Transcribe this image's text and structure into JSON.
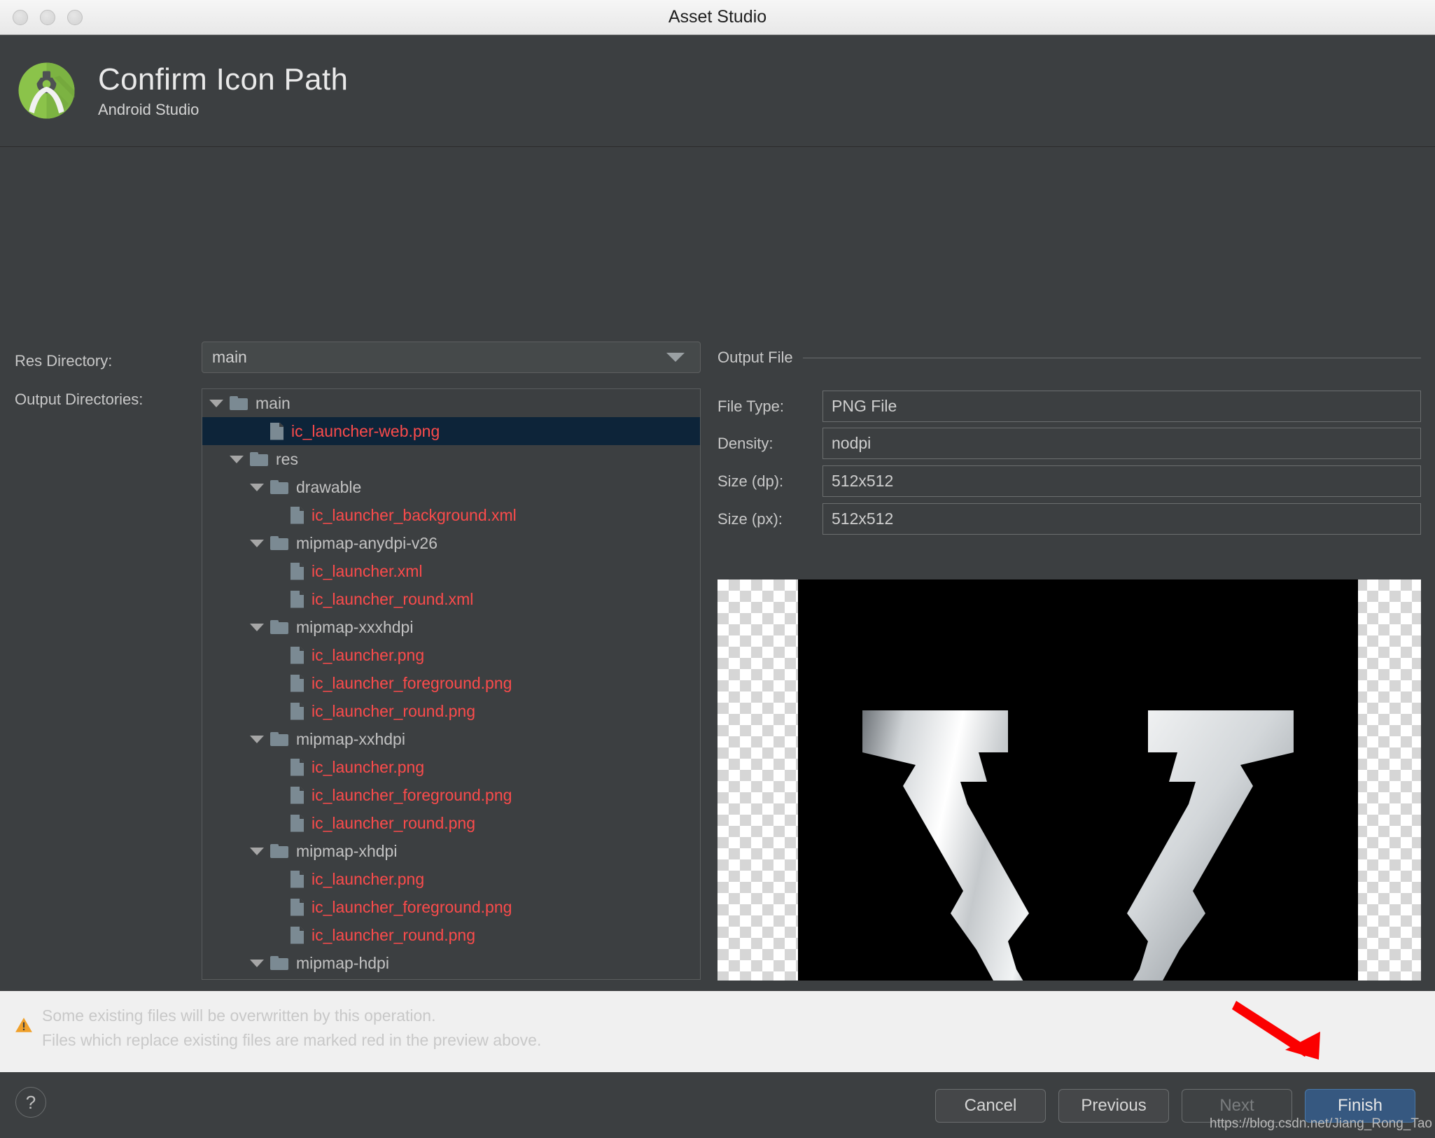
{
  "window": {
    "title": "Asset Studio",
    "traffic_lights": [
      "close",
      "minimize",
      "zoom"
    ]
  },
  "header": {
    "title": "Confirm Icon Path",
    "subtitle": "Android Studio",
    "logo_icon": "android-studio-logo-icon"
  },
  "form": {
    "res_directory_label": "Res Directory:",
    "res_directory_value": "main",
    "output_directories_label": "Output Directories:"
  },
  "tree": [
    {
      "depth": 0,
      "type": "folder",
      "label": "main",
      "expanded": true,
      "selected": false,
      "red": false
    },
    {
      "depth": 2,
      "type": "file",
      "label": "ic_launcher-web.png",
      "expanded": false,
      "selected": true,
      "red": true
    },
    {
      "depth": 1,
      "type": "folder",
      "label": "res",
      "expanded": true,
      "selected": false,
      "red": false
    },
    {
      "depth": 2,
      "type": "folder",
      "label": "drawable",
      "expanded": true,
      "selected": false,
      "red": false
    },
    {
      "depth": 3,
      "type": "file",
      "label": "ic_launcher_background.xml",
      "expanded": false,
      "selected": false,
      "red": true
    },
    {
      "depth": 2,
      "type": "folder",
      "label": "mipmap-anydpi-v26",
      "expanded": true,
      "selected": false,
      "red": false
    },
    {
      "depth": 3,
      "type": "file",
      "label": "ic_launcher.xml",
      "expanded": false,
      "selected": false,
      "red": true
    },
    {
      "depth": 3,
      "type": "file",
      "label": "ic_launcher_round.xml",
      "expanded": false,
      "selected": false,
      "red": true
    },
    {
      "depth": 2,
      "type": "folder",
      "label": "mipmap-xxxhdpi",
      "expanded": true,
      "selected": false,
      "red": false
    },
    {
      "depth": 3,
      "type": "file",
      "label": "ic_launcher.png",
      "expanded": false,
      "selected": false,
      "red": true
    },
    {
      "depth": 3,
      "type": "file",
      "label": "ic_launcher_foreground.png",
      "expanded": false,
      "selected": false,
      "red": true
    },
    {
      "depth": 3,
      "type": "file",
      "label": "ic_launcher_round.png",
      "expanded": false,
      "selected": false,
      "red": true
    },
    {
      "depth": 2,
      "type": "folder",
      "label": "mipmap-xxhdpi",
      "expanded": true,
      "selected": false,
      "red": false
    },
    {
      "depth": 3,
      "type": "file",
      "label": "ic_launcher.png",
      "expanded": false,
      "selected": false,
      "red": true
    },
    {
      "depth": 3,
      "type": "file",
      "label": "ic_launcher_foreground.png",
      "expanded": false,
      "selected": false,
      "red": true
    },
    {
      "depth": 3,
      "type": "file",
      "label": "ic_launcher_round.png",
      "expanded": false,
      "selected": false,
      "red": true
    },
    {
      "depth": 2,
      "type": "folder",
      "label": "mipmap-xhdpi",
      "expanded": true,
      "selected": false,
      "red": false
    },
    {
      "depth": 3,
      "type": "file",
      "label": "ic_launcher.png",
      "expanded": false,
      "selected": false,
      "red": true
    },
    {
      "depth": 3,
      "type": "file",
      "label": "ic_launcher_foreground.png",
      "expanded": false,
      "selected": false,
      "red": true
    },
    {
      "depth": 3,
      "type": "file",
      "label": "ic_launcher_round.png",
      "expanded": false,
      "selected": false,
      "red": true
    },
    {
      "depth": 2,
      "type": "folder",
      "label": "mipmap-hdpi",
      "expanded": true,
      "selected": false,
      "red": false
    }
  ],
  "output_file": {
    "group_title": "Output File",
    "fields": [
      {
        "label": "File Type:",
        "value": "PNG File"
      },
      {
        "label": "Density:",
        "value": "nodpi"
      },
      {
        "label": "Size (dp):",
        "value": "512x512"
      },
      {
        "label": "Size (px):",
        "value": "512x512"
      }
    ]
  },
  "preview": {
    "icon_description": "ic_launcher-web preview: silver V monogram on black rounded square over transparency checkerboard"
  },
  "warning": {
    "icon": "warning-triangle-icon",
    "line1": "Some existing files will be overwritten by this operation.",
    "line2": "Files which replace existing files are marked red in the preview above."
  },
  "footer": {
    "help_label": "?",
    "buttons": [
      {
        "label": "Cancel",
        "state": "enabled"
      },
      {
        "label": "Previous",
        "state": "enabled"
      },
      {
        "label": "Next",
        "state": "disabled"
      },
      {
        "label": "Finish",
        "state": "primary"
      }
    ],
    "watermark": "https://blog.csdn.net/Jiang_Rong_Tao"
  },
  "annotation": {
    "arrow_color": "#fb0000",
    "points_to": "Finish"
  },
  "colors": {
    "window_bg": "#3c3f41",
    "titlebar_bg": "#eeeeee",
    "selection_bg": "#0d2439",
    "red_file": "#fb4b4b",
    "primary_button": "#365880",
    "warning_amber": "#f0a02a",
    "logo_green": "#77c043"
  }
}
